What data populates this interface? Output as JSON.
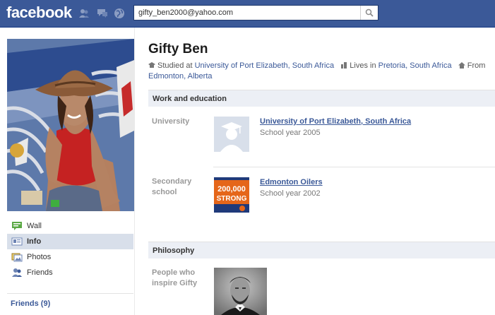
{
  "brand": {
    "logo": "facebook",
    "color": "#3b5998"
  },
  "search": {
    "value": "gifty_ben2000@yahoo.com",
    "icon": "search-icon"
  },
  "nav": [
    {
      "label": "Wall",
      "icon": "wall-icon",
      "active": false
    },
    {
      "label": "Info",
      "icon": "info-icon",
      "active": true
    },
    {
      "label": "Photos",
      "icon": "photos-icon",
      "active": false
    },
    {
      "label": "Friends",
      "icon": "friends-icon",
      "active": false
    }
  ],
  "friends_link": "Friends (9)",
  "profile": {
    "name": "Gifty Ben",
    "bio": {
      "studied_prefix": "Studied at",
      "studied_link": "University of Port Elizabeth, South Africa",
      "lives_prefix": "Lives in",
      "lives_link": "Pretoria, South Africa",
      "from_prefix": "From",
      "from_link": "Edmonton, Alberta"
    }
  },
  "work_education": {
    "heading": "Work and education",
    "university": {
      "label": "University",
      "title": "University of Port Elizabeth, South Africa",
      "sub": "School year 2005"
    },
    "secondary": {
      "label": "Secondary school",
      "title": "Edmonton Oilers",
      "sub": "School year 2002",
      "thumb_text_1": "200,000",
      "thumb_text_2": "STRONG"
    }
  },
  "philosophy": {
    "heading": "Philosophy",
    "label": "People who inspire Gifty"
  }
}
